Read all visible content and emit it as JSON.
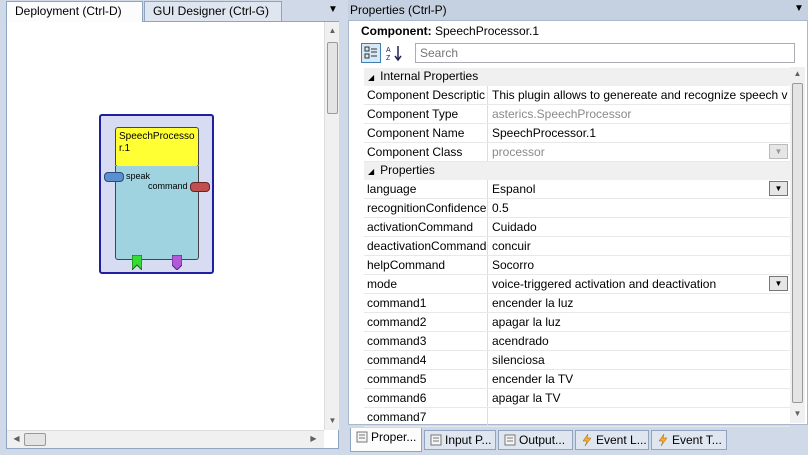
{
  "left": {
    "tabs": [
      {
        "label": "Deployment (Ctrl-D)"
      },
      {
        "label": "GUI Designer (Ctrl-G)"
      }
    ],
    "component": {
      "title": "SpeechProcessor.1",
      "input_port": "speak",
      "output_port": "command"
    }
  },
  "right": {
    "title": "Properties (Ctrl-P)",
    "component_label": "Component:",
    "component_name": "SpeechProcessor.1",
    "search_placeholder": "Search",
    "categories": [
      {
        "label": "Internal Properties",
        "rows": [
          {
            "name": "Component Descriptic",
            "value": "This plugin allows to genereate and recognize speech v"
          },
          {
            "name": "Component Type",
            "value": "asterics.SpeechProcessor"
          },
          {
            "name": "Component Name",
            "value": "SpeechProcessor.1"
          },
          {
            "name": "Component Class",
            "value": "processor"
          }
        ]
      },
      {
        "label": "Properties",
        "rows": [
          {
            "name": "language",
            "value": "Espanol"
          },
          {
            "name": "recognitionConfidence",
            "value": "0.5"
          },
          {
            "name": "activationCommand",
            "value": "Cuidado"
          },
          {
            "name": "deactivationCommand",
            "value": "concuir"
          },
          {
            "name": "helpCommand",
            "value": "Socorro"
          },
          {
            "name": "mode",
            "value": "voice-triggered activation and deactivation"
          },
          {
            "name": "command1",
            "value": "encender la luz"
          },
          {
            "name": "command2",
            "value": "apagar la luz"
          },
          {
            "name": "command3",
            "value": "acendrado"
          },
          {
            "name": "command4",
            "value": "silenciosa"
          },
          {
            "name": "command5",
            "value": "encender la TV"
          },
          {
            "name": "command6",
            "value": "apagar la TV"
          },
          {
            "name": "command7",
            "value": ""
          }
        ]
      }
    ]
  },
  "bottom_tabs": [
    {
      "label": "Proper..."
    },
    {
      "label": "Input P..."
    },
    {
      "label": "Output..."
    },
    {
      "label": "Event L..."
    },
    {
      "label": "Event T..."
    }
  ],
  "colors": {
    "component_header": "#ffff33",
    "component_body": "#9fd3df",
    "component_border": "#1f1f9f",
    "input_port": "#5b8fcf",
    "output_port": "#c05050"
  }
}
